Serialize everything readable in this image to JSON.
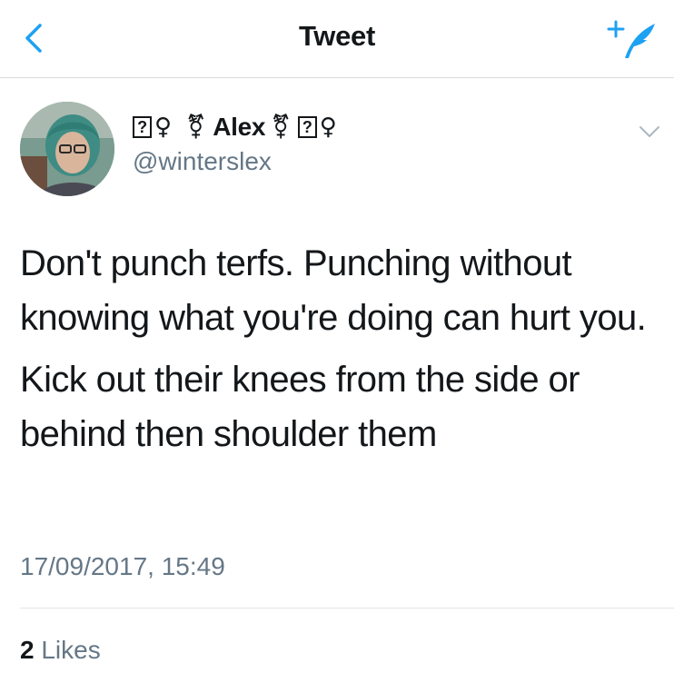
{
  "header": {
    "title": "Tweet",
    "back_icon": "chevron-left-icon",
    "compose_icon": "compose-tweet-icon",
    "accent_color": "#1da1f2"
  },
  "tweet": {
    "author": {
      "display_name": "Alex",
      "name_prefix_box": "?",
      "name_prefix_symbol": "♀",
      "name_symbol_before": "⚧",
      "name_symbol_after": "⚧",
      "name_suffix_box": "?",
      "name_suffix_symbol": "♀",
      "handle": "@winterslex",
      "avatar_icon": "avatar"
    },
    "menu_icon": "chevron-down-icon",
    "paragraphs": [
      "Don't punch terfs. Punching without knowing what you're doing can hurt you.",
      "Kick out their knees from the side or behind then shoulder them"
    ],
    "timestamp": "17/09/2017, 15:49",
    "likes_count": "2",
    "likes_label": "Likes"
  }
}
